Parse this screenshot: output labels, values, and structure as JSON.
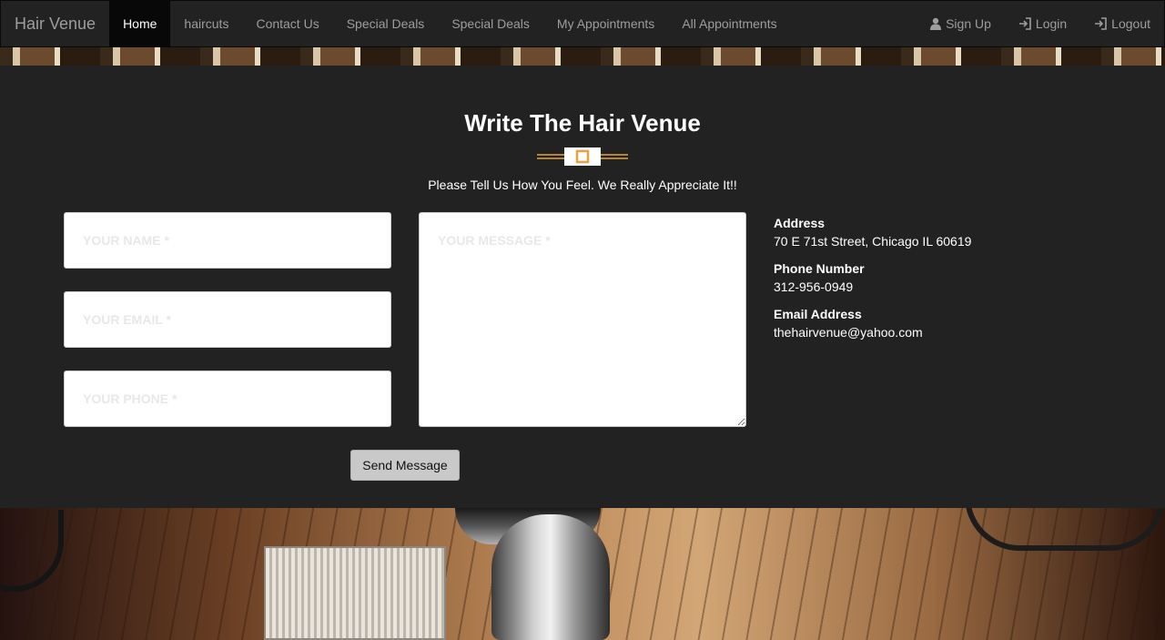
{
  "navbar": {
    "brand": "Hair Venue",
    "items": [
      {
        "label": "Home",
        "active": true
      },
      {
        "label": "haircuts"
      },
      {
        "label": "Contact Us"
      },
      {
        "label": "Special Deals"
      },
      {
        "label": "Special Deals"
      },
      {
        "label": "My Appointments"
      },
      {
        "label": "All Appointments"
      }
    ],
    "right_items": [
      {
        "label": "Sign Up",
        "icon": "user-icon"
      },
      {
        "label": "Login",
        "icon": "login-icon"
      },
      {
        "label": "Logout",
        "icon": "logout-icon"
      }
    ]
  },
  "contact": {
    "title": "Write The Hair Venue",
    "subtitle": "Please Tell Us How You Feel. We Really Appreciate It!!",
    "form": {
      "name_placeholder": "YOUR NAME *",
      "email_placeholder": "YOUR EMAIL *",
      "phone_placeholder": "YOUR PHONE *",
      "message_placeholder": "YOUR MESSAGE *",
      "send_label": "Send Message"
    },
    "info": {
      "address_label": "Address",
      "address_value": "70 E 71st Street, Chicago IL 60619",
      "phone_label": "Phone Number",
      "phone_value": "312-956-0949",
      "email_label": "Email Address",
      "email_value": "thehairvenue@yahoo.com"
    }
  },
  "colors": {
    "navbar_bg": "#222222",
    "panel_bg": "#222222",
    "accent": "#e8a33a"
  }
}
